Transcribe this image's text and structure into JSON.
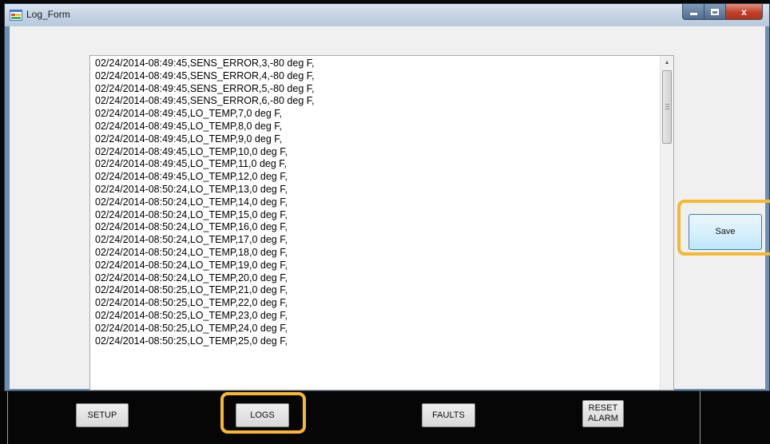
{
  "window": {
    "title": "Log_Form",
    "controls": {
      "minimize": "",
      "maximize": "",
      "close": "x"
    }
  },
  "log": {
    "lines": [
      "02/24/2014-08:49:45,SENS_ERROR,3,-80 deg F,",
      "02/24/2014-08:49:45,SENS_ERROR,4,-80 deg F,",
      "02/24/2014-08:49:45,SENS_ERROR,5,-80 deg F,",
      "02/24/2014-08:49:45,SENS_ERROR,6,-80 deg F,",
      "02/24/2014-08:49:45,LO_TEMP,7,0 deg F,",
      "02/24/2014-08:49:45,LO_TEMP,8,0 deg F,",
      "02/24/2014-08:49:45,LO_TEMP,9,0 deg F,",
      "02/24/2014-08:49:45,LO_TEMP,10,0 deg F,",
      "02/24/2014-08:49:45,LO_TEMP,11,0 deg F,",
      "02/24/2014-08:49:45,LO_TEMP,12,0 deg F,",
      "02/24/2014-08:50:24,LO_TEMP,13,0 deg F,",
      "02/24/2014-08:50:24,LO_TEMP,14,0 deg F,",
      "02/24/2014-08:50:24,LO_TEMP,15,0 deg F,",
      "02/24/2014-08:50:24,LO_TEMP,16,0 deg F,",
      "02/24/2014-08:50:24,LO_TEMP,17,0 deg F,",
      "02/24/2014-08:50:24,LO_TEMP,18,0 deg F,",
      "02/24/2014-08:50:24,LO_TEMP,19,0 deg F,",
      "02/24/2014-08:50:24,LO_TEMP,20,0 deg F,",
      "02/24/2014-08:50:25,LO_TEMP,21,0 deg F,",
      "02/24/2014-08:50:25,LO_TEMP,22,0 deg F,",
      "02/24/2014-08:50:25,LO_TEMP,23,0 deg F,",
      "02/24/2014-08:50:25,LO_TEMP,24,0 deg F,",
      "02/24/2014-08:50:25,LO_TEMP,25,0 deg F,"
    ]
  },
  "actions": {
    "save_label": "Save"
  },
  "nav": {
    "setup": "SETUP",
    "logs": "LOGS",
    "faults": "FAULTS",
    "reset_alarm_line1": "RESET",
    "reset_alarm_line2": "ALARM"
  },
  "colors": {
    "highlight": "#f5b82e",
    "window_frame": "#6b8fb3",
    "client_bg": "#f0f0f0",
    "close_button": "#c2402a"
  },
  "icons": {
    "app": "form-icon",
    "scroll_up": "up-arrow-icon",
    "thumb_grip": "grip-icon"
  }
}
